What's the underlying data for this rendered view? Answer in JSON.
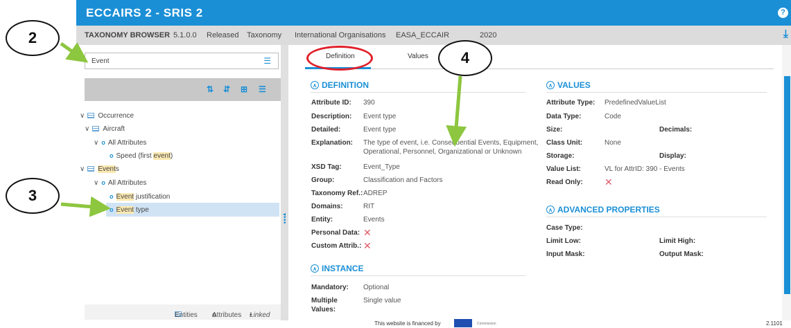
{
  "header": {
    "app_title": "ECCAIRS 2 - SRIS 2",
    "help_icon": "?"
  },
  "subheader": {
    "browser": "TAXONOMY BROWSER",
    "version": "5.1.0.0",
    "status": "Released",
    "type": "Taxonomy",
    "org": "International Organisations",
    "taxonomy": "EASA_ECCAIR",
    "year": "2020"
  },
  "search": {
    "value": "Event"
  },
  "tree": {
    "occurrence": "Occurrence",
    "aircraft": "Aircraft",
    "all_attributes_1": "All Attributes",
    "speed_pre": "Speed (first ",
    "speed_hl": "event",
    "speed_post": ")",
    "events_hl": "Event",
    "events_post": "s",
    "all_attributes_2": "All Attributes",
    "justification_hl": "Event",
    "justification_post": " justification",
    "type_hl": "Event",
    "type_post": " type"
  },
  "legend": {
    "entities": "Entities",
    "attributes": "Attributes",
    "linked": "Linked"
  },
  "tabs": {
    "definition": "Definition",
    "values": "Values"
  },
  "definition": {
    "title": "DEFINITION",
    "fields": [
      {
        "label": "Attribute ID:",
        "value": "390"
      },
      {
        "label": "Description:",
        "value": "Event type"
      },
      {
        "label": "Detailed:",
        "value": "Event type"
      },
      {
        "label": "Explanation:",
        "value": "The type of event, i.e. Consequential Events, Equipment,",
        "value2": "Operational, Personnel, Organizational or Unknown"
      },
      {
        "label": "XSD Tag:",
        "value": "Event_Type"
      },
      {
        "label": "Group:",
        "value": "Classification and Factors"
      },
      {
        "label": "Taxonomy Ref.:",
        "value": "ADREP"
      },
      {
        "label": "Domains:",
        "value": "RIT"
      },
      {
        "label": "Entity:",
        "value": "Events"
      },
      {
        "label": "Personal Data:",
        "value": ""
      },
      {
        "label": "Custom Attrib.:",
        "value": ""
      }
    ]
  },
  "instance": {
    "title": "INSTANCE",
    "mandatory_label": "Mandatory:",
    "mandatory_value": "Optional",
    "multiple_label": "Multiple",
    "multiple_label2": "Values:",
    "multiple_value": "Single value"
  },
  "values_section": {
    "title": "VALUES",
    "attribute_type_label": "Attribute Type:",
    "attribute_type_value": "PredefinedValueList",
    "data_type_label": "Data Type:",
    "data_type_value": "Code",
    "size_label": "Size:",
    "decimals_label": "Decimals:",
    "class_unit_label": "Class Unit:",
    "class_unit_value": "None",
    "storage_label": "Storage:",
    "display_label": "Display:",
    "value_list_label": "Value List:",
    "value_list_value": "VL for AttrID: 390 - Events",
    "read_only_label": "Read Only:"
  },
  "advanced": {
    "title": "ADVANCED PROPERTIES",
    "case_type": "Case Type:",
    "limit_low": "Limit Low:",
    "limit_high": "Limit High:",
    "input_mask": "Input Mask:",
    "output_mask": "Output Mask:"
  },
  "footer": {
    "financed": "This website is financed by",
    "commission": "Commission",
    "version": "2.1101"
  },
  "annotations": {
    "a2": "2",
    "a3": "3",
    "a4": "4"
  },
  "colors": {
    "brand": "#1a8fd6",
    "annotation_arrow": "#8dc63f",
    "highlight_ring": "#e0202a",
    "cross": "#e05a6a"
  }
}
